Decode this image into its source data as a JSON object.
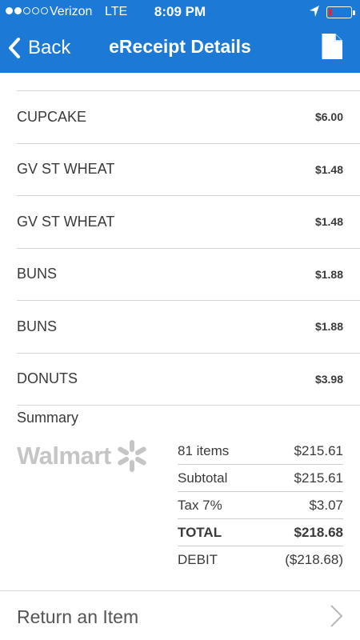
{
  "status_bar": {
    "carrier": "Verizon",
    "network": "LTE",
    "time": "8:09 PM",
    "signal_bars_filled": 2,
    "signal_bars_total": 5,
    "battery_level_percent": 15,
    "battery_color": "#e8243a"
  },
  "nav": {
    "back_label": "Back",
    "title": "eReceipt Details",
    "accent_color": "#1c7ad6"
  },
  "items": [
    {
      "name": "CUPCAKE",
      "price": "$6.00"
    },
    {
      "name": "GV ST WHEAT",
      "price": "$1.48"
    },
    {
      "name": "GV ST WHEAT",
      "price": "$1.48"
    },
    {
      "name": "BUNS",
      "price": "$1.88"
    },
    {
      "name": "BUNS",
      "price": "$1.88"
    },
    {
      "name": "DONUTS",
      "price": "$3.98"
    }
  ],
  "summary": {
    "heading": "Summary",
    "logo_text": "Walmart",
    "rows": [
      {
        "label": "81 items",
        "value": "$215.61"
      },
      {
        "label": "Subtotal",
        "value": "$215.61"
      },
      {
        "label": "Tax 7%",
        "value": "$3.07"
      },
      {
        "label": "TOTAL",
        "value": "$218.68"
      },
      {
        "label": "DEBIT",
        "value": "($218.68)"
      }
    ]
  },
  "footer": {
    "return_label": "Return an Item"
  }
}
